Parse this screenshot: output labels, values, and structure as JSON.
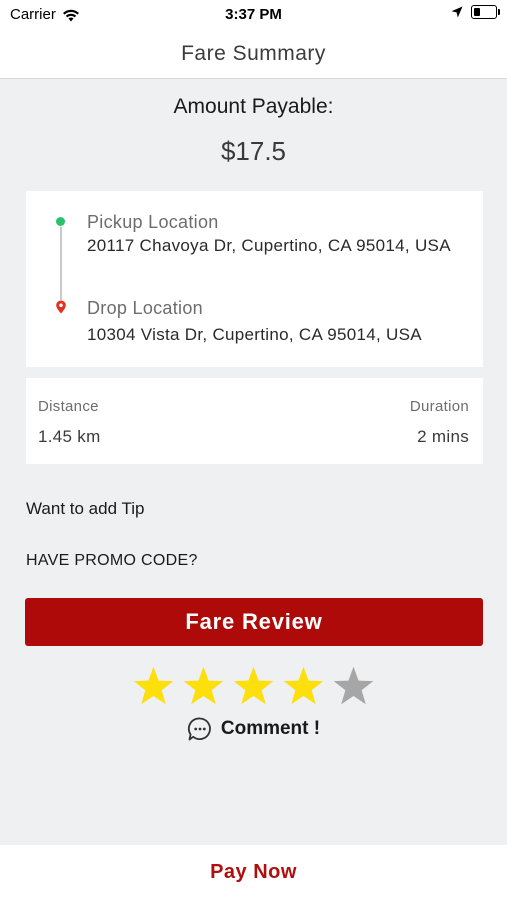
{
  "status_bar": {
    "carrier": "Carrier",
    "time": "3:37 PM",
    "icons": [
      "wifi-icon",
      "location-arrow-icon",
      "battery-icon"
    ]
  },
  "nav": {
    "title": "Fare Summary"
  },
  "fare": {
    "amount_label": "Amount Payable:",
    "amount_value": "$17.5"
  },
  "route": {
    "pickup_label": "Pickup Location",
    "pickup_address": "20117 Chavoya Dr, Cupertino, CA 95014, USA",
    "drop_label": "Drop Location",
    "drop_address": "10304 Vista Dr, Cupertino, CA 95014, USA"
  },
  "trip_stats": {
    "distance_label": "Distance",
    "distance_value": "1.45 km",
    "duration_label": "Duration",
    "duration_value": "2 mins"
  },
  "tip": {
    "label": "Want to add Tip"
  },
  "promo": {
    "label": "HAVE PROMO CODE?"
  },
  "fare_review": {
    "label": "Fare Review"
  },
  "rating": {
    "value": 4,
    "max": 5,
    "filled_color": "#fddf0c",
    "empty_color": "#a6a6a6"
  },
  "comment": {
    "label": "Comment !"
  },
  "pay_now": {
    "label": "Pay Now"
  },
  "colors": {
    "accent": "#ae0a0a",
    "pay_now_text": "#b00f0f",
    "pickup_dot": "#29c16b",
    "drop_pin": "#e0321e",
    "background": "#eef0f2"
  }
}
